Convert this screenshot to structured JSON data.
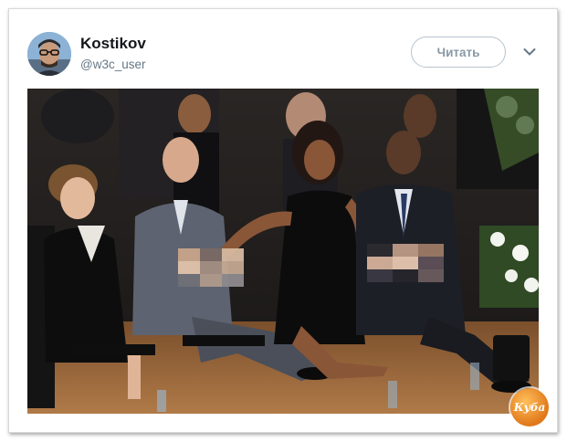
{
  "tweet": {
    "author_name": "Kostikov",
    "author_handle": "@w3c_user",
    "follow_label": "Читать",
    "menu_icon": "chevron-down-icon",
    "avatar_icon": "avatar"
  },
  "photo": {
    "watermark_text": "Куба"
  },
  "colors": {
    "name_text": "#14171a",
    "handle_text": "#657786",
    "follow_border": "#b6c3cc",
    "follow_text": "#8899a6",
    "badge_orange": "#e0781a"
  }
}
